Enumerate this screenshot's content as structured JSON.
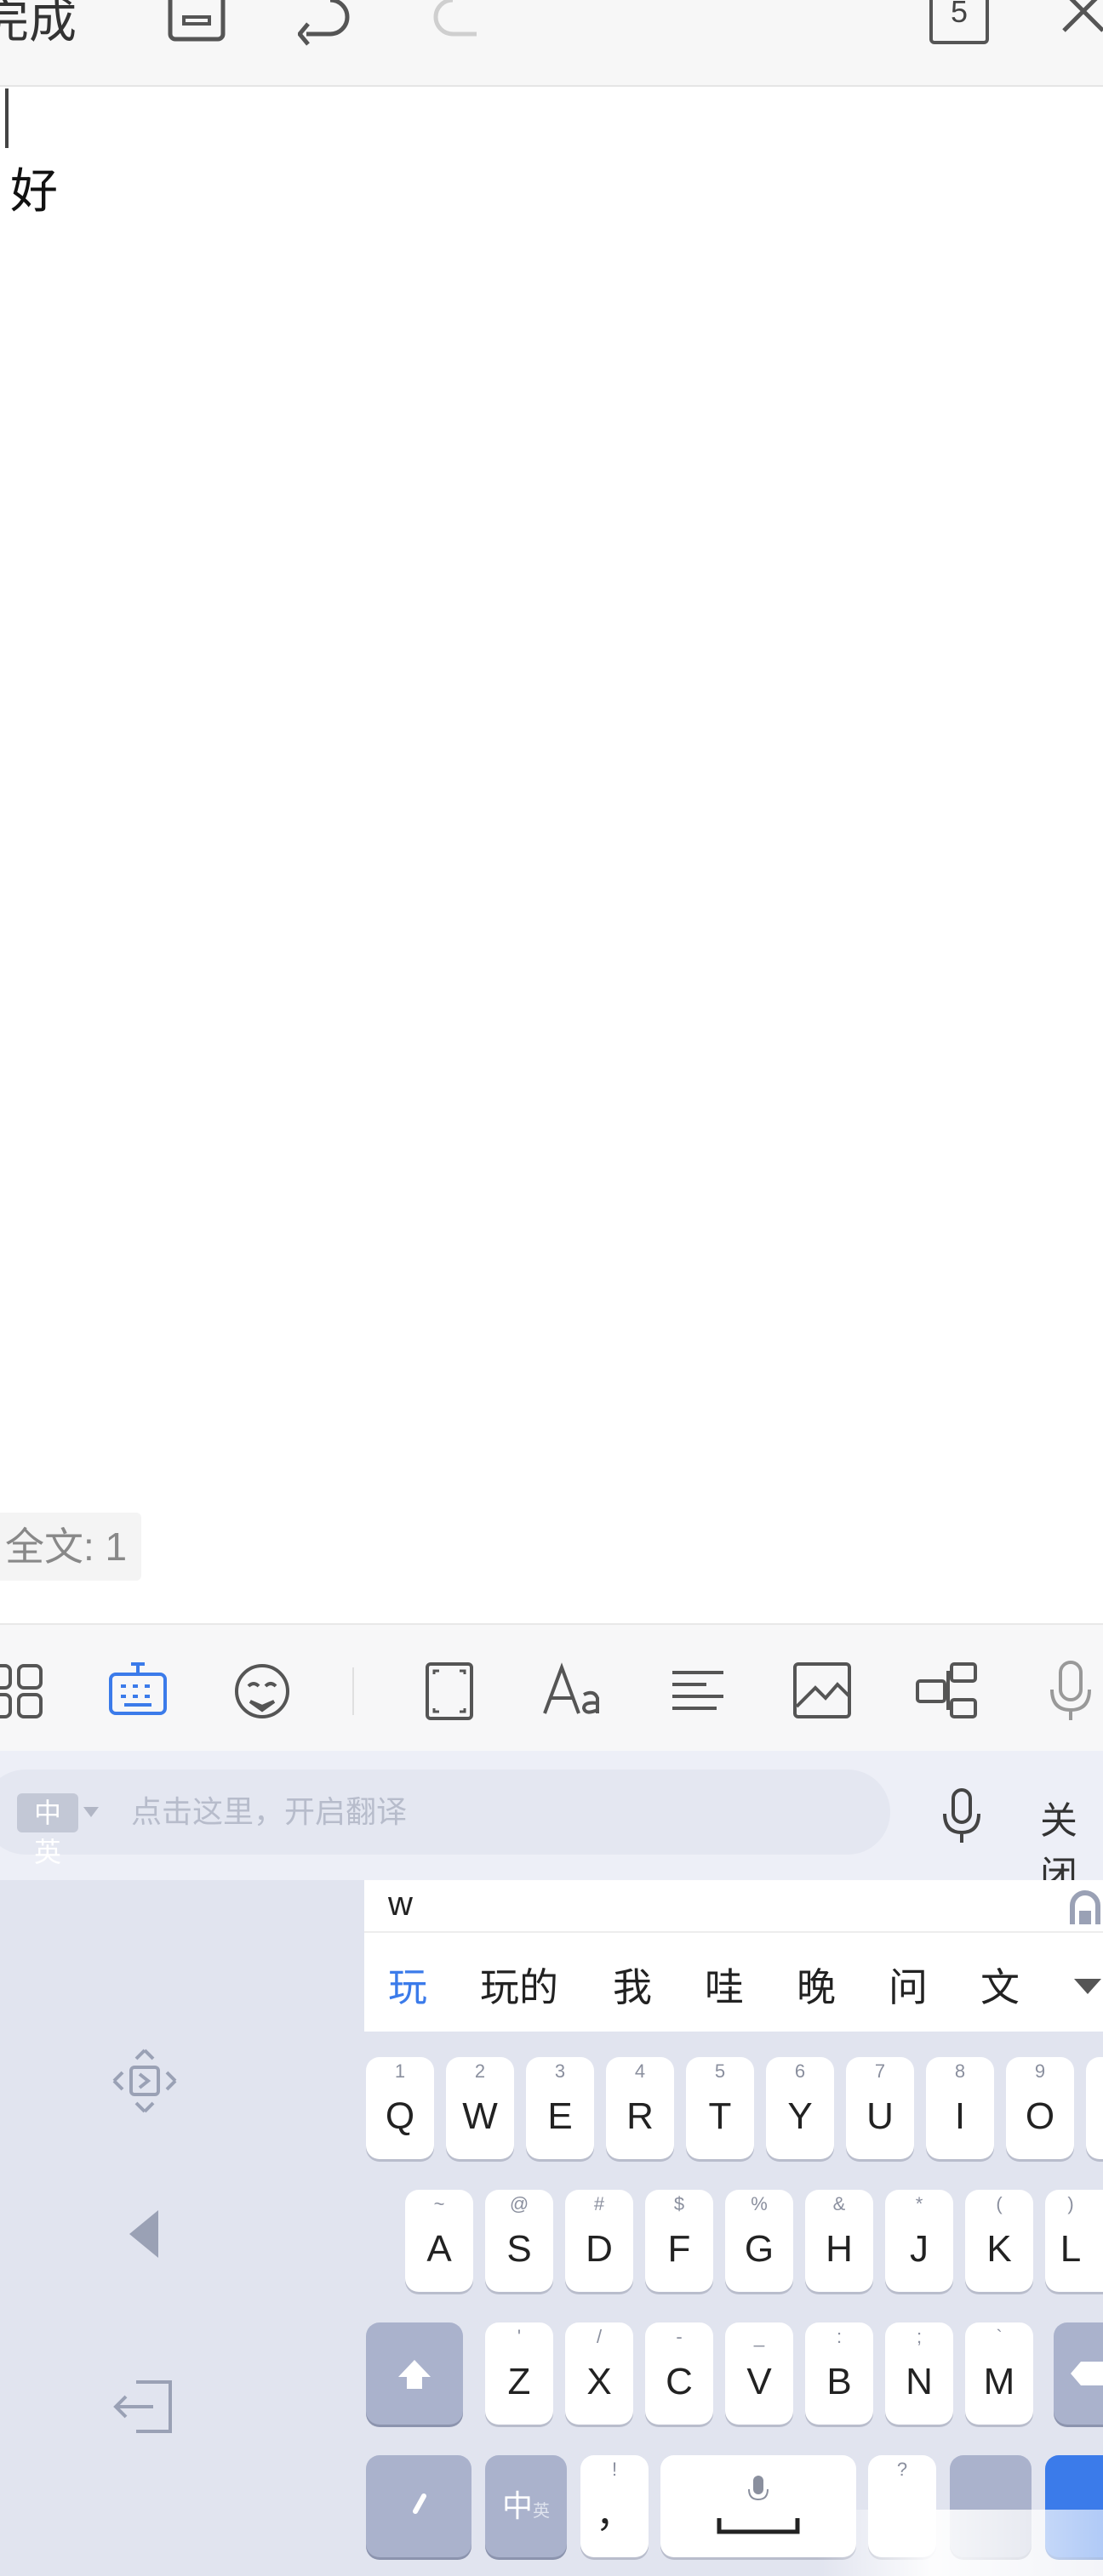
{
  "topbar": {
    "done_label": "完成",
    "save_icon": "save-icon",
    "undo_icon": "undo-icon",
    "redo_icon": "redo-icon",
    "page_count": "5",
    "close_icon": "close-icon"
  },
  "document": {
    "text": "好",
    "word_count": "全文: 1"
  },
  "edit_toolbar": {
    "items": [
      {
        "name": "apps-grid-icon"
      },
      {
        "name": "keyboard-icon",
        "active": true
      },
      {
        "name": "sticker-icon"
      },
      {
        "name": "fullscreen-icon"
      },
      {
        "name": "font-icon"
      },
      {
        "name": "align-icon"
      },
      {
        "name": "image-icon"
      },
      {
        "name": "mindmap-icon"
      },
      {
        "name": "mic-icon"
      }
    ],
    "accent_color": "#3b7bea"
  },
  "translate_bar": {
    "lang_toggle": "中英",
    "placeholder": "点击这里，开启翻译",
    "close_label": "关闭"
  },
  "keyboard": {
    "pinyin": "w",
    "candidates": [
      "玩",
      "玩的",
      "我",
      "哇",
      "晚",
      "问",
      "文"
    ],
    "row1": [
      {
        "sub": "1",
        "main": "Q"
      },
      {
        "sub": "2",
        "main": "W"
      },
      {
        "sub": "3",
        "main": "E"
      },
      {
        "sub": "4",
        "main": "R"
      },
      {
        "sub": "5",
        "main": "T"
      },
      {
        "sub": "6",
        "main": "Y"
      },
      {
        "sub": "7",
        "main": "U"
      },
      {
        "sub": "8",
        "main": "I"
      },
      {
        "sub": "9",
        "main": "O"
      }
    ],
    "row2": [
      {
        "sub": "~",
        "main": "A"
      },
      {
        "sub": "@",
        "main": "S"
      },
      {
        "sub": "#",
        "main": "D"
      },
      {
        "sub": "$",
        "main": "F"
      },
      {
        "sub": "%",
        "main": "G"
      },
      {
        "sub": "&",
        "main": "H"
      },
      {
        "sub": "*",
        "main": "J"
      },
      {
        "sub": "(",
        "main": "K"
      },
      {
        "sub": ")",
        "main": "L"
      }
    ],
    "row3": [
      {
        "sub": "'",
        "main": "Z"
      },
      {
        "sub": "/",
        "main": "X"
      },
      {
        "sub": "-",
        "main": "C"
      },
      {
        "sub": "_",
        "main": "V"
      },
      {
        "sub": ":",
        "main": "B"
      },
      {
        "sub": ";",
        "main": "N"
      },
      {
        "sub": "`",
        "main": "M"
      }
    ],
    "lang_key": "中",
    "lang_key_sub": "英",
    "comma_key": "，",
    "comma_sub": "!",
    "question_sub": "?"
  }
}
